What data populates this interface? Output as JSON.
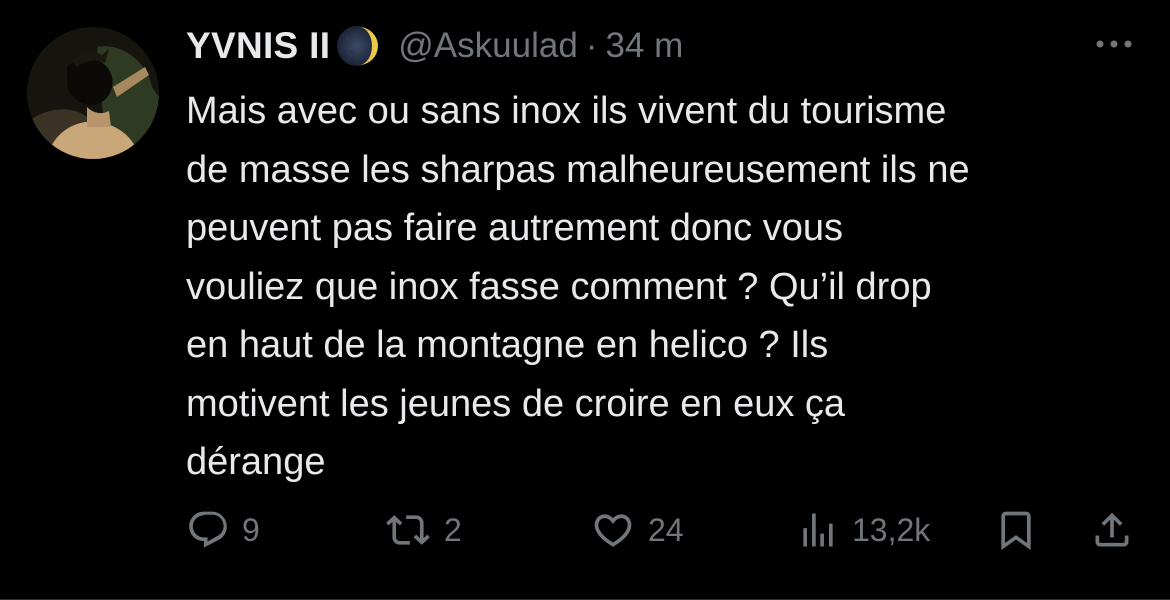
{
  "author": {
    "display_name": "YVNIS II",
    "handle": "@Askuulad",
    "separator": "·",
    "time": "34 m"
  },
  "icons": {
    "avatar": "avatar-illustration",
    "badge": "crescent-moon-icon",
    "more": "more-options-icon",
    "reply": "reply-icon",
    "retweet": "retweet-icon",
    "like": "like-icon",
    "views": "views-icon",
    "bookmark": "bookmark-icon",
    "share": "share-icon"
  },
  "tweet": {
    "lines": [
      "Mais avec ou sans inox ils vivent du tourisme",
      "de masse les sharpas malheureusement ils ne",
      "peuvent pas faire autrement donc vous",
      "vouliez que inox fasse comment ? Qu’il drop",
      "en haut de la montagne en helico ? Ils",
      "motivent les jeunes de croire en eux ça",
      "dérange"
    ]
  },
  "actions": {
    "replies": "9",
    "retweets": "2",
    "likes": "24",
    "views": "13,2k"
  },
  "colors": {
    "background": "#000000",
    "text": "#e7e9ea",
    "secondary": "#71767b"
  }
}
